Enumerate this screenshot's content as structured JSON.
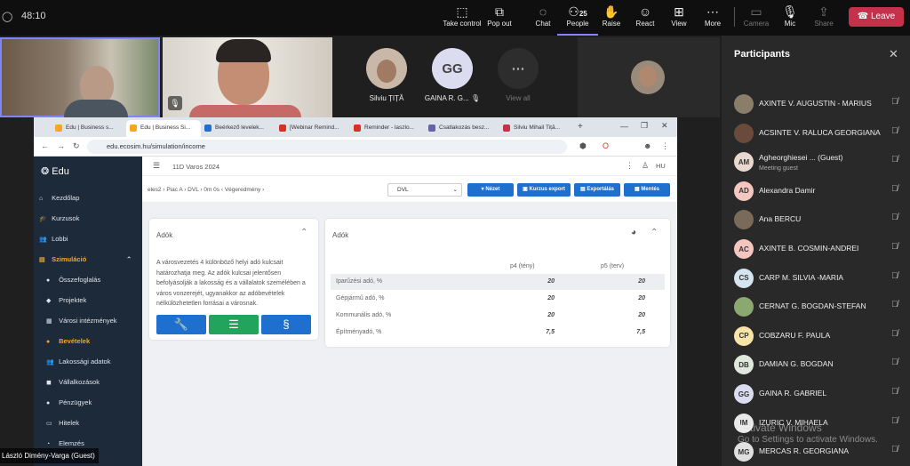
{
  "meeting": {
    "timer": "48:10",
    "toolbar": [
      {
        "icon": "take-control-icon",
        "label": "Take control"
      },
      {
        "icon": "pop-out-icon",
        "label": "Pop out"
      },
      {
        "icon": "chat-icon",
        "label": "Chat"
      },
      {
        "icon": "people-icon",
        "label": "People",
        "count": "25"
      },
      {
        "icon": "raise-hand-icon",
        "label": "Raise"
      },
      {
        "icon": "react-icon",
        "label": "React"
      },
      {
        "icon": "view-icon",
        "label": "View"
      },
      {
        "icon": "more-icon",
        "label": "More"
      },
      {
        "icon": "camera-off-icon",
        "label": "Camera"
      },
      {
        "icon": "mic-off-icon",
        "label": "Mic"
      },
      {
        "icon": "share-icon",
        "label": "Share"
      }
    ],
    "leave_label": "Leave",
    "accent": "#7f85f5",
    "leave_color": "#c4314b"
  },
  "stage": {
    "tiles": [
      {
        "name": "Silviu ȚIȚĂ"
      },
      {
        "initials": "GG",
        "name": "GAINA R. G..."
      },
      {
        "name": "View all"
      }
    ],
    "presenter_name": "László Dimény-Varga (Guest)"
  },
  "participants": {
    "title": "Participants",
    "list": [
      {
        "initials": "",
        "name": "AXINTE V. AUGUSTIN - MARIUS",
        "color": "#8a7e6a"
      },
      {
        "initials": "",
        "name": "ACSINTE V. RALUCA GEORGIANA",
        "color": "#6a4a3a"
      },
      {
        "initials": "AM",
        "name": "Agheorghiesei ... (Guest)",
        "sub": "Meeting guest",
        "color": "#e8d8d0"
      },
      {
        "initials": "AD",
        "name": "Alexandra Damir",
        "color": "#f4c6c0"
      },
      {
        "initials": "",
        "name": "Ana BERCU",
        "color": "#7a6a5a"
      },
      {
        "initials": "AC",
        "name": "AXINTE B. COSMIN-ANDREI",
        "color": "#f4c6c0"
      },
      {
        "initials": "CS",
        "name": "CARP M. SILVIA -MARIA",
        "color": "#d4e4f0"
      },
      {
        "initials": "",
        "name": "CERNAT G. BOGDAN-STEFAN",
        "color": "#8aa870"
      },
      {
        "initials": "CP",
        "name": "COBZARU F. PAULA",
        "color": "#f8e4a8"
      },
      {
        "initials": "DB",
        "name": "DAMIAN G. BOGDAN",
        "color": "#dfe8dc"
      },
      {
        "initials": "GG",
        "name": "GAINA R. GABRIEL",
        "color": "#dcdcf0"
      },
      {
        "initials": "IM",
        "name": "IZURIC V. MIHAELA",
        "color": "#e8e8e8"
      },
      {
        "initials": "MG",
        "name": "MERCAS R. GEORGIANA",
        "color": "#e0e0e0"
      }
    ],
    "watermark_title": "Activate Windows",
    "watermark_sub": "Go to Settings to activate Windows."
  },
  "browser": {
    "tabs": [
      "Edu | Business s...",
      "Edu | Business Si...",
      "Beérkező levelek...",
      "[Webinar Remind...",
      "Reminder - laszlo...",
      "Csatlakozás besz...",
      "Silviu Mihail Tiță..."
    ],
    "url": "edu.ecosim.hu/simulation/income"
  },
  "app": {
    "logo": "Edu",
    "header_title": "11D Varos 2024",
    "lang": "HU",
    "sidebar": [
      {
        "label": "Kezdőlap",
        "level": 0
      },
      {
        "label": "Kurzusok",
        "level": 0
      },
      {
        "label": "Lobbi",
        "level": 0
      },
      {
        "label": "Szimuláció",
        "level": 0,
        "highlight": true
      },
      {
        "label": "Összefoglalás",
        "level": 1
      },
      {
        "label": "Projektek",
        "level": 1
      },
      {
        "label": "Városi intézmények",
        "level": 1
      },
      {
        "label": "Bevételek",
        "level": 1,
        "highlight": true
      },
      {
        "label": "Lakossági adatok",
        "level": 1
      },
      {
        "label": "Vállalkozások",
        "level": 1
      },
      {
        "label": "Pénzügyek",
        "level": 1
      },
      {
        "label": "Hitelek",
        "level": 1
      },
      {
        "label": "Elemzés",
        "level": 1
      }
    ],
    "breadcrumb": "eles2  ›  Piac A  ›  DVL  ›  0m 0s  ‹  Végeredmény  ›",
    "select_value": "DVL",
    "buttons": [
      "▾ Nézet",
      "Kurzus export",
      "Exportálás",
      "Mentés"
    ],
    "left_card": {
      "title": "Adók",
      "description": "A városvezetés 4 különböző helyi adó kulcsait határozhatja meg. Az adók kulcsai jelentősen befolyásolják a lakosság és a vállalatok személében a város vonzerejét, ugyanakkor az adóbevételek nélkülözhetetlen forrásai a városnak."
    },
    "right_card": {
      "title": "Adók",
      "columns": [
        "p4 (tény)",
        "p5 (terv)"
      ],
      "rows": [
        {
          "label": "Iparűzési adó, %",
          "p4": "20",
          "p5": "20"
        },
        {
          "label": "Gépjármű adó, %",
          "p4": "20",
          "p5": "20"
        },
        {
          "label": "Kommunális adó, %",
          "p4": "20",
          "p5": "20"
        },
        {
          "label": "Építményadó, %",
          "p4": "7,5",
          "p5": "7,5"
        }
      ]
    }
  }
}
